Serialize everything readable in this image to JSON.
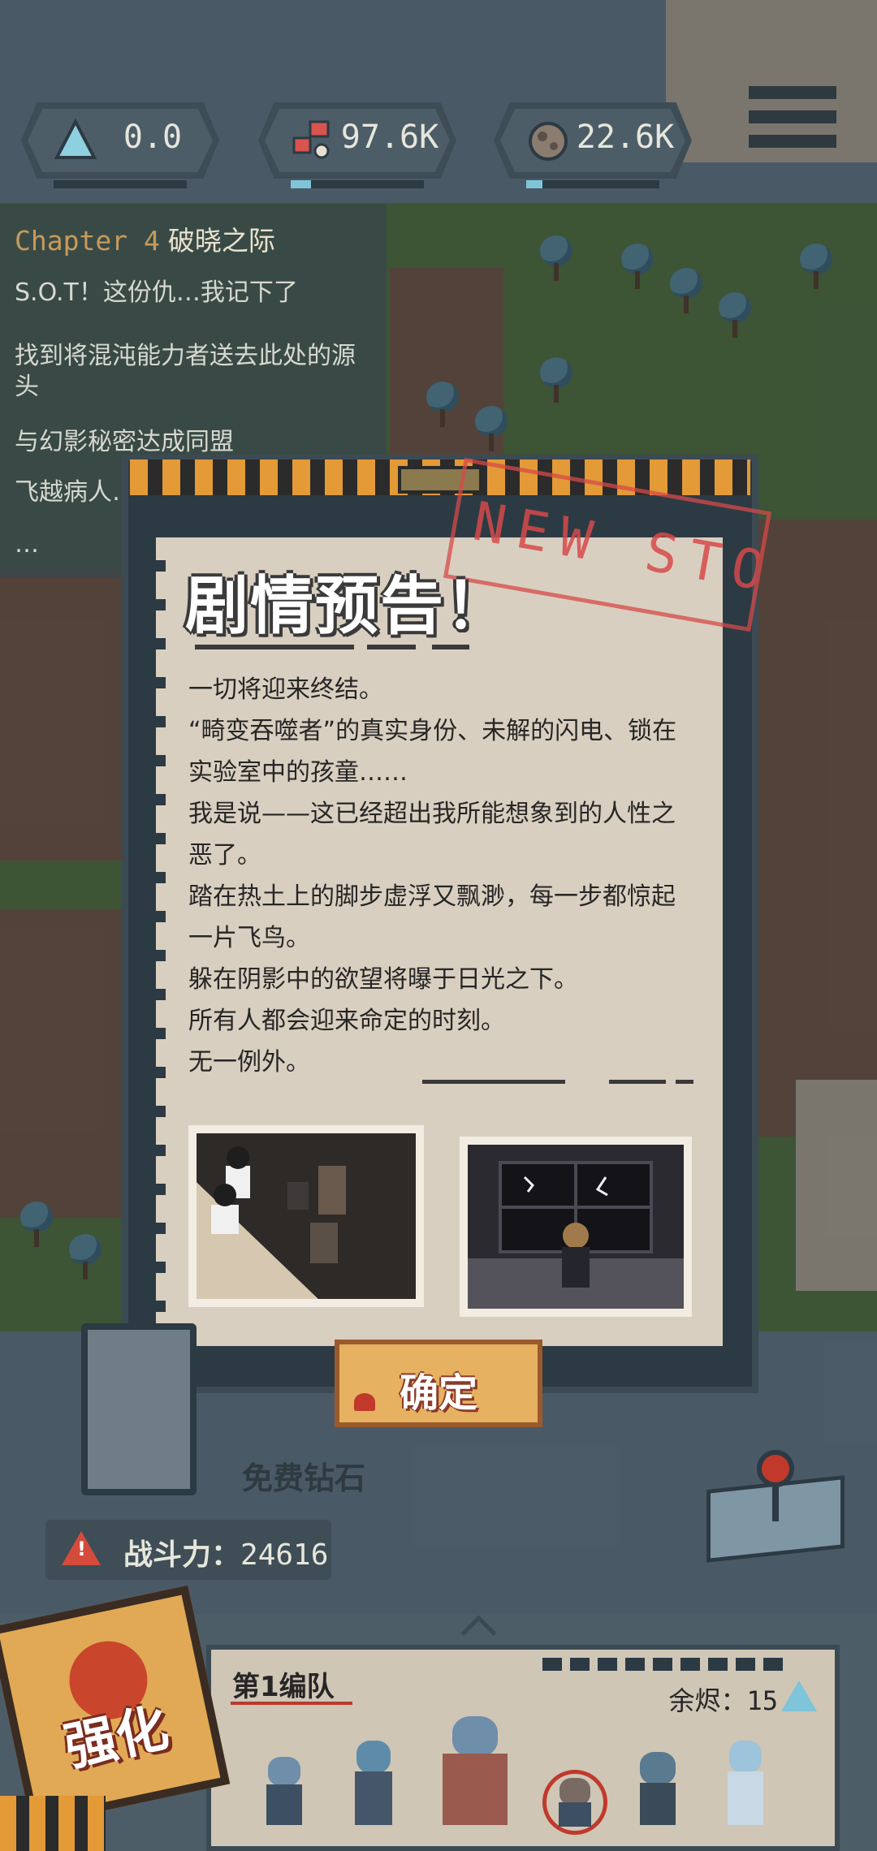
{
  "resources": [
    {
      "icon": "crystal-icon",
      "value": "0.0",
      "fill": 0.0
    },
    {
      "icon": "material-icon",
      "value": "97.6K",
      "fill": 0.15
    },
    {
      "icon": "ore-icon",
      "value": "22.6K",
      "fill": 0.12
    }
  ],
  "quest": {
    "chapter": "Chapter 4",
    "chapter_name": "破晓之际",
    "items": [
      "S.O.T！这份仇…我记下了",
      "找到将混沌能力者送去此处的源头",
      "与幻影秘密达成同盟",
      "飞越病人…",
      "…"
    ]
  },
  "dialog": {
    "stamp": "NEW STORY",
    "title": "剧情预告！",
    "lines": [
      "一切将迎来终结。",
      "“畸变吞噬者”的真实身份、未解的闪电、锁在实验室中的孩童……",
      "我是说——这已经超出我所能想象到的人性之恶了。",
      "踏在热土上的脚步虚浮又飘渺，每一步都惊起一片飞鸟。",
      "躲在阴影中的欲望将曝于日光之下。",
      "所有人都会迎来命定的时刻。",
      "无一例外。"
    ],
    "confirm_label": "确定"
  },
  "hud": {
    "free_diamond_label": "免费钻石",
    "power_label": "战斗力：",
    "power_value": "24616"
  },
  "squad": {
    "name": "第1编队",
    "energy_label": "余烬：",
    "energy_value": "15"
  },
  "upgrade_label": "强化",
  "colors": {
    "accent_orange": "#e39a37",
    "stamp_red": "#d64a4a",
    "paper": "#d9cfc0",
    "frame": "#2c3a44"
  }
}
